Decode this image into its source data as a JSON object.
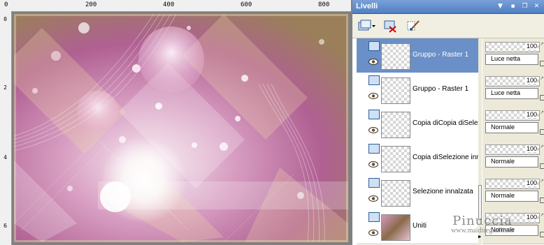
{
  "ruler": {
    "top": [
      "0",
      "200",
      "400",
      "600",
      "800"
    ],
    "left": [
      "0",
      "2",
      "4",
      "6"
    ]
  },
  "panel": {
    "title": "Livelli",
    "buttons": [
      "pin-icon",
      "menu-icon",
      "restore-icon",
      "close-icon"
    ]
  },
  "toolbar": [
    {
      "icon": "new-layer-icon"
    },
    {
      "icon": "delete-layer-icon"
    },
    {
      "icon": "edit-brush-icon"
    }
  ],
  "layers": [
    {
      "name": "Gruppo - Raster 1",
      "opacity": "100",
      "blend": "Luce netta",
      "selected": true
    },
    {
      "name": "Gruppo - Raster 1",
      "opacity": "100",
      "blend": "Luce netta",
      "selected": false
    },
    {
      "name": "Copia diCopia diSelezio",
      "opacity": "100",
      "blend": "Normale",
      "selected": false
    },
    {
      "name": "Copia diSelezione innal",
      "opacity": "100",
      "blend": "Normale",
      "selected": false
    },
    {
      "name": "Selezione innalzata",
      "opacity": "100",
      "blend": "Normale",
      "selected": false
    },
    {
      "name": "Uniti",
      "opacity": "100",
      "blend": "Normale",
      "selected": false
    }
  ],
  "watermark": {
    "name": "Pinuccia",
    "site": "www.maidiregrafica.it"
  },
  "colors": {
    "selected_row": "#6b8fc7",
    "title_bar": "#4f7fc5",
    "panel_bg": "#ece9d8"
  }
}
